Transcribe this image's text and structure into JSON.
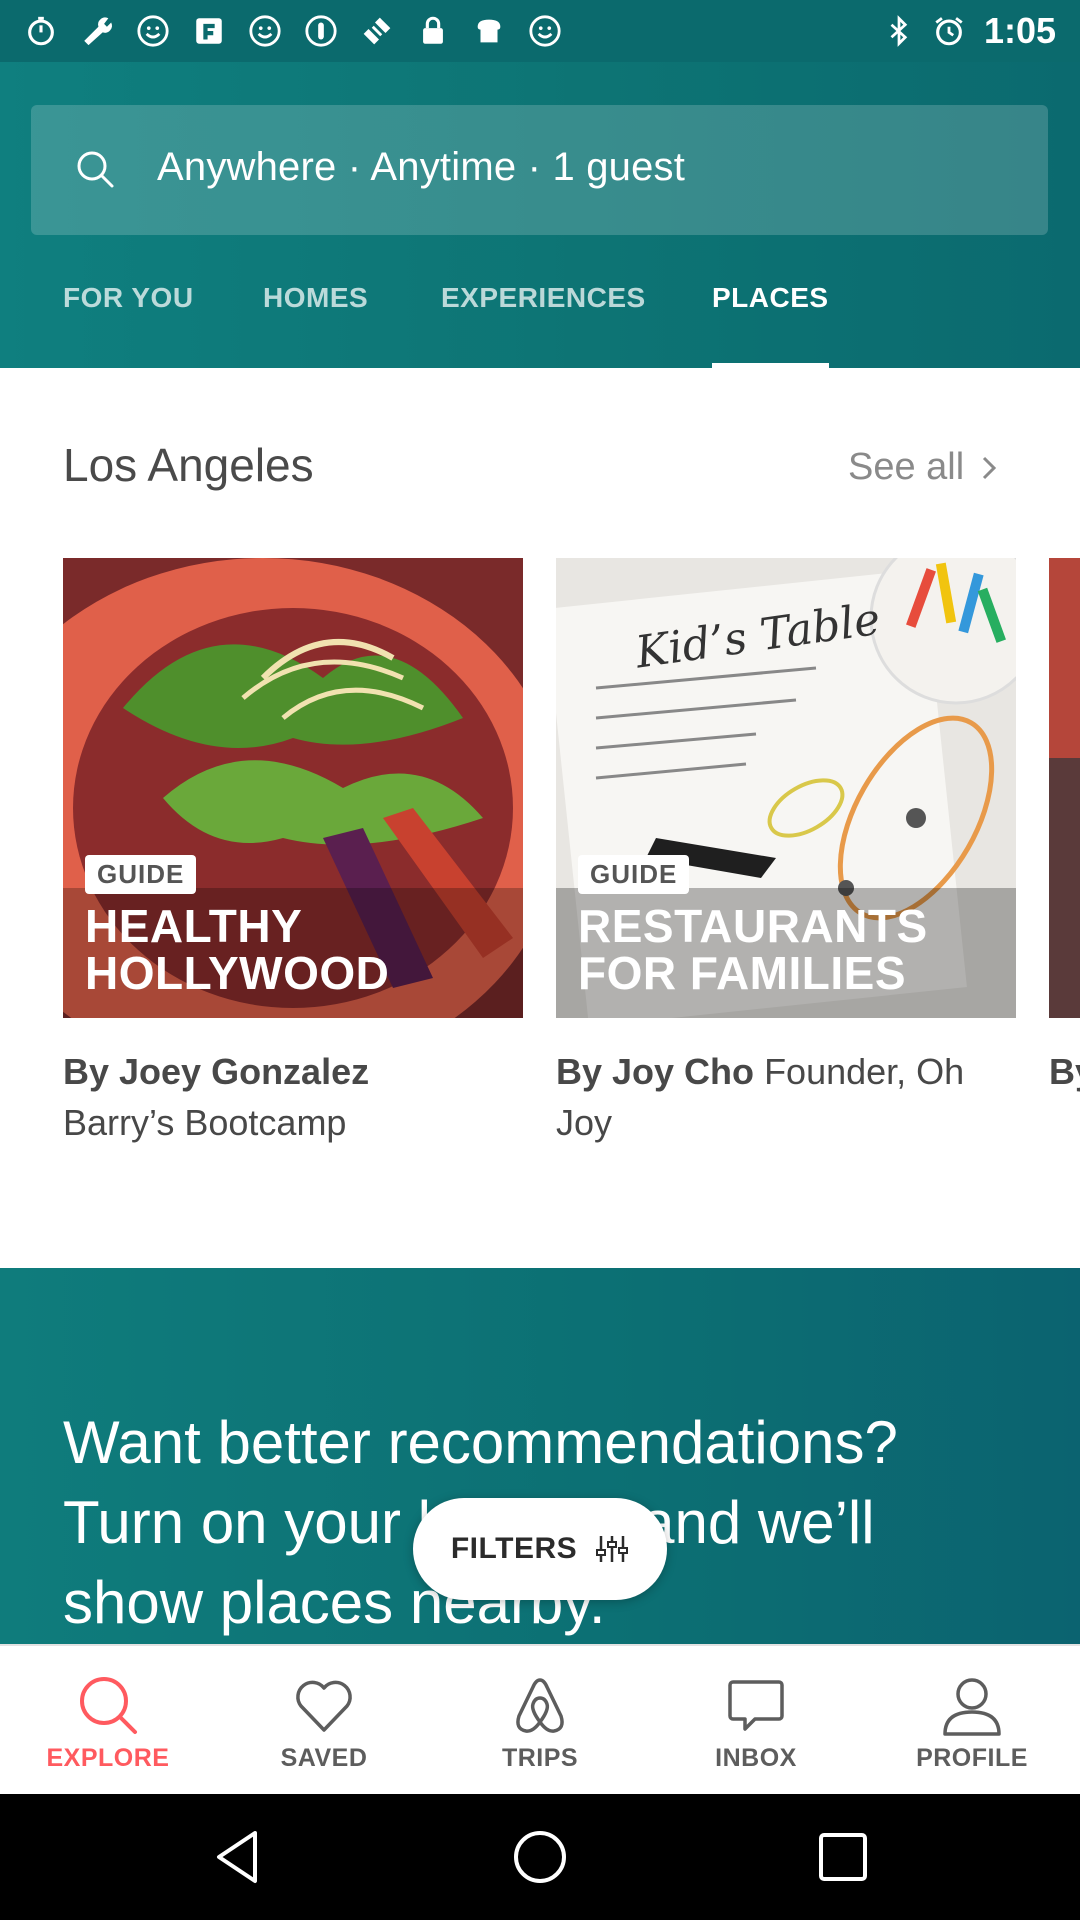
{
  "status_bar": {
    "time": "1:05",
    "left_icons": [
      "timer-icon",
      "wrench-icon",
      "smiley-icon",
      "fandango-icon",
      "smiley-icon",
      "smiley-icon",
      "pill-icon",
      "satellite-icon",
      "lock-icon",
      "toast-icon",
      "smiley-icon"
    ],
    "right_icons": [
      "bluetooth-icon",
      "alarm-icon"
    ]
  },
  "search": {
    "placeholder": "Anywhere · Anytime · 1 guest"
  },
  "tabs": [
    {
      "label": "FOR YOU",
      "active": false
    },
    {
      "label": "HOMES",
      "active": false
    },
    {
      "label": "EXPERIENCES",
      "active": false
    },
    {
      "label": "PLACES",
      "active": true
    }
  ],
  "section": {
    "title": "Los Angeles",
    "see_all": "See all"
  },
  "cards": [
    {
      "badge": "GUIDE",
      "title_line1": "HEALTHY",
      "title_line2": "HOLLYWOOD",
      "author": "By Joey Gonzalez",
      "subtitle": "Barry’s Bootcamp"
    },
    {
      "badge": "GUIDE",
      "title_line1": "RESTAURANTS",
      "title_line2": "FOR FAMILIES",
      "author": "By Joy Cho",
      "subtitle": "Founder, Oh Joy",
      "menu_text": "Kid’s Table"
    },
    {
      "author": "By"
    }
  ],
  "banner": {
    "text": "Want better recommendations? Turn on your location and we’ll show places nearby."
  },
  "filters": {
    "label": "FILTERS"
  },
  "bottom_nav": [
    {
      "label": "EXPLORE",
      "icon": "search-icon",
      "active": true
    },
    {
      "label": "SAVED",
      "icon": "heart-icon",
      "active": false
    },
    {
      "label": "TRIPS",
      "icon": "airbnb-logo-icon",
      "active": false
    },
    {
      "label": "INBOX",
      "icon": "chat-bubble-icon",
      "active": false
    },
    {
      "label": "PROFILE",
      "icon": "person-icon",
      "active": false
    }
  ],
  "colors": {
    "header_teal": "#0d7474",
    "accent_red": "#ff5a5f",
    "text_dark": "#484848"
  }
}
